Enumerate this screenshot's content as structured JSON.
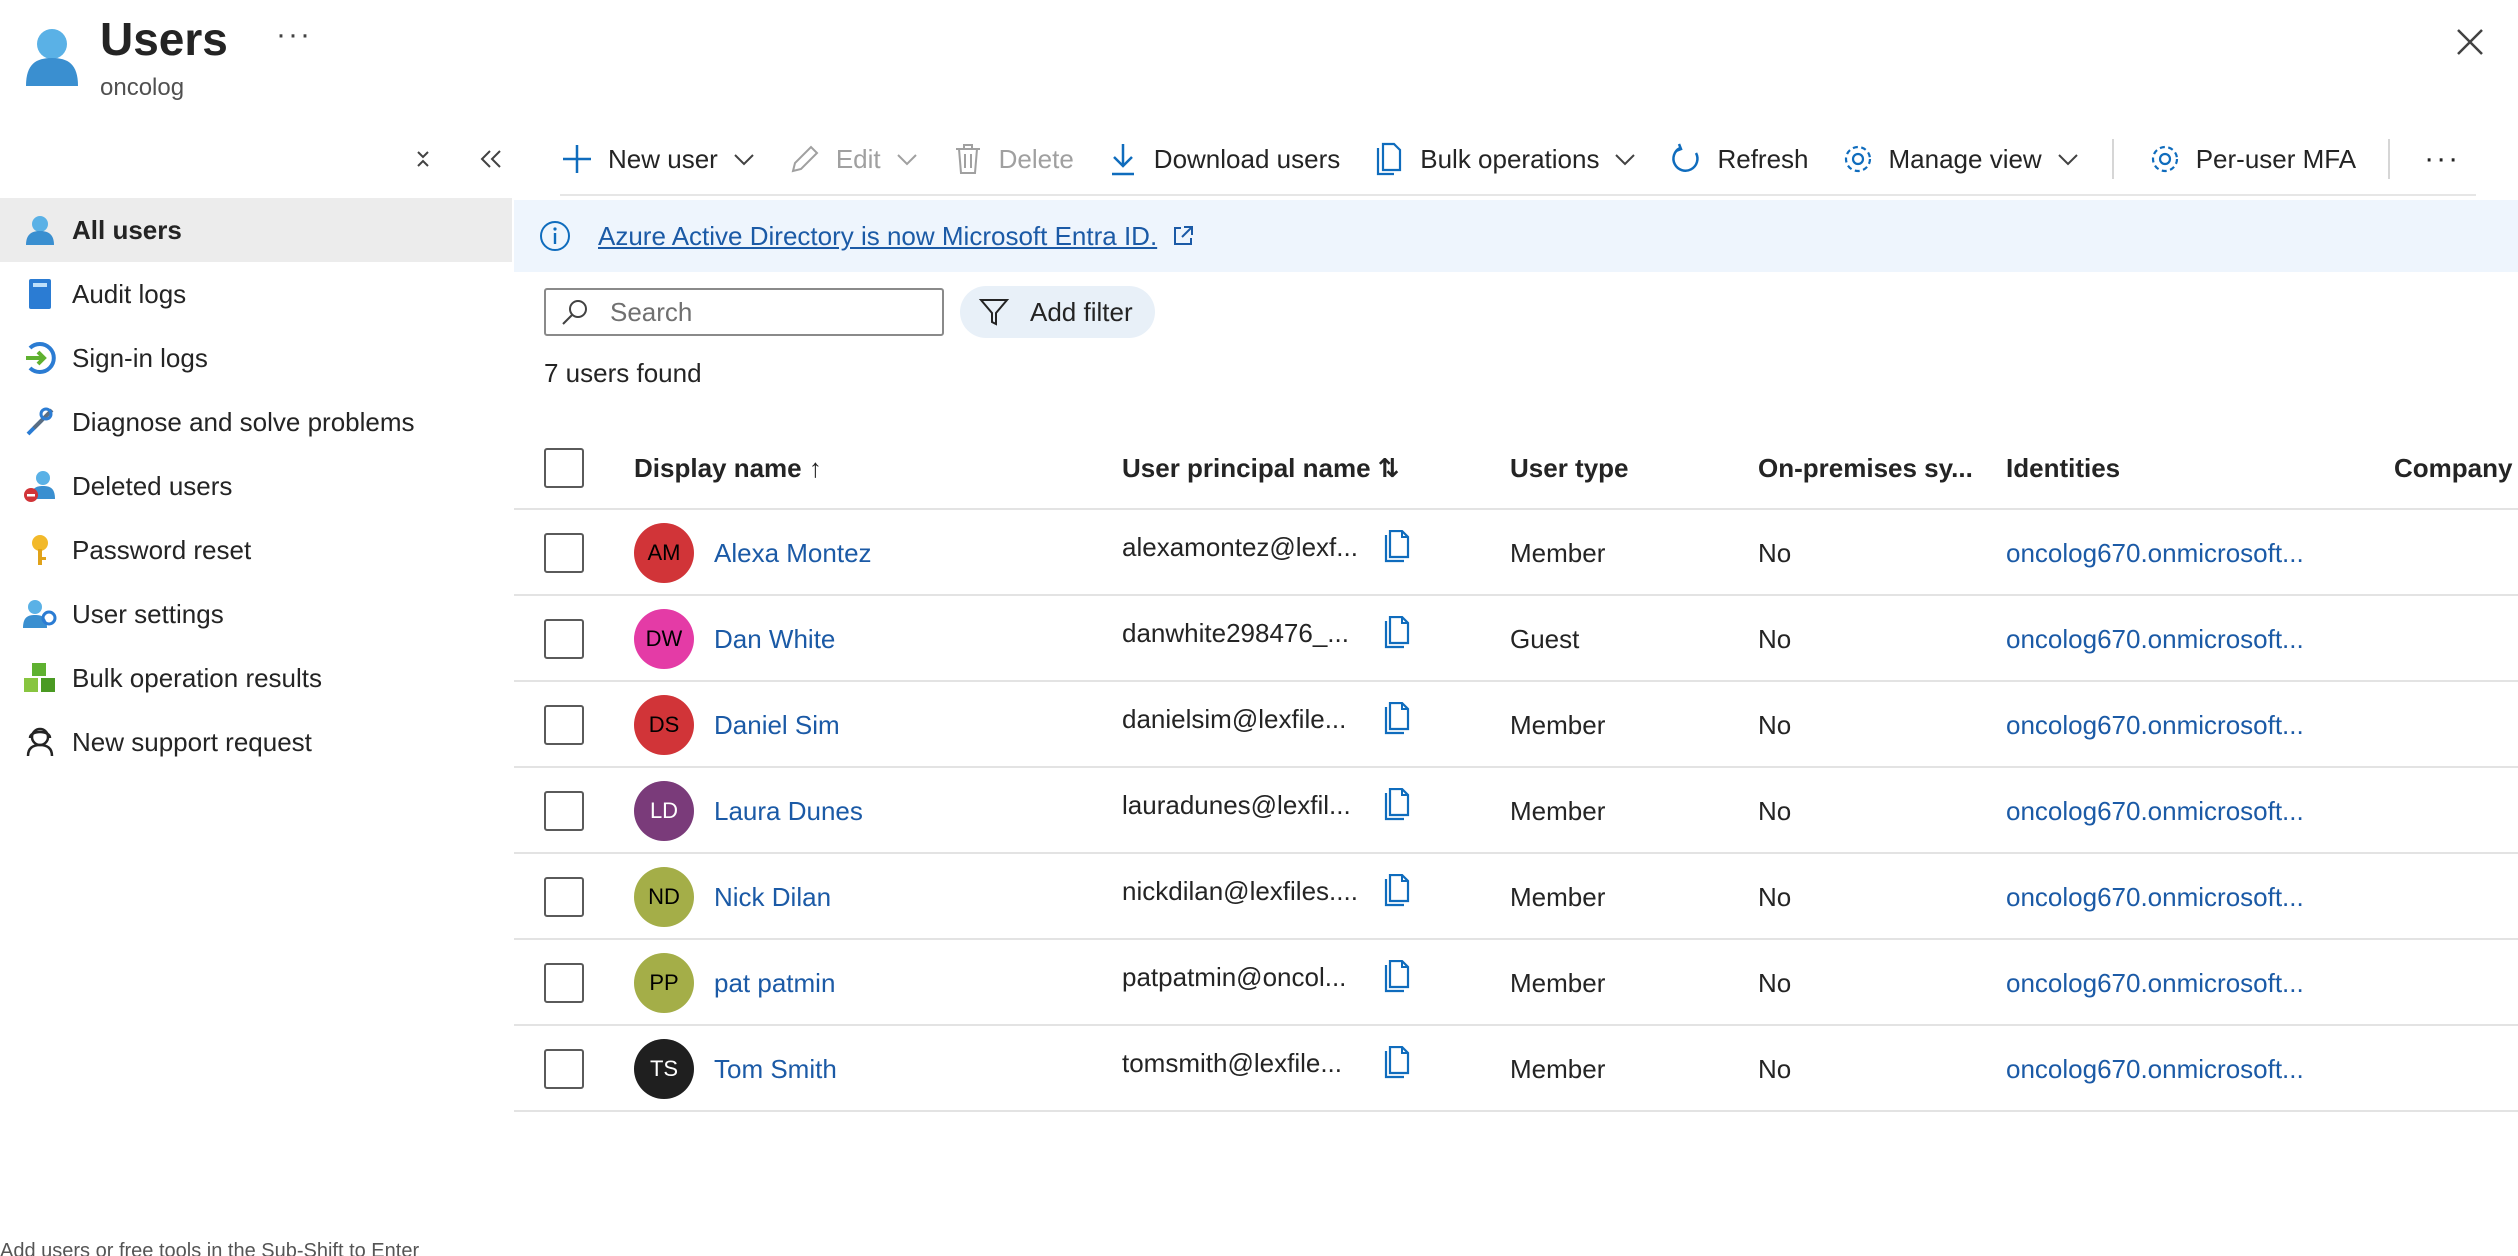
{
  "header": {
    "title": "Users",
    "subtitle": "oncolog",
    "more_label": "···"
  },
  "toolbar": {
    "new_user": "New user",
    "edit": "Edit",
    "delete": "Delete",
    "download_users": "Download users",
    "bulk_operations": "Bulk operations",
    "refresh": "Refresh",
    "manage_view": "Manage view",
    "per_user_mfa": "Per-user MFA",
    "more_label": "···"
  },
  "sidebar": {
    "items": [
      {
        "label": "All users",
        "icon": "user-icon",
        "active": true
      },
      {
        "label": "Audit logs",
        "icon": "book-icon"
      },
      {
        "label": "Sign-in logs",
        "icon": "sign-in-icon"
      },
      {
        "label": "Diagnose and solve problems",
        "icon": "wrench-icon"
      },
      {
        "label": "Deleted users",
        "icon": "deleted-user-icon"
      },
      {
        "label": "Password reset",
        "icon": "key-icon"
      },
      {
        "label": "User settings",
        "icon": "user-settings-icon"
      },
      {
        "label": "Bulk operation results",
        "icon": "cubes-icon"
      },
      {
        "label": "New support request",
        "icon": "support-icon"
      }
    ],
    "footer": "Add users or free tools in the Sub-Shift to Enter"
  },
  "banner": {
    "text": "Azure Active Directory is now Microsoft Entra ID."
  },
  "search": {
    "placeholder": "Search"
  },
  "filter": {
    "label": "Add filter"
  },
  "results": {
    "count_text": "7 users found"
  },
  "table": {
    "columns": [
      "Display name ↑",
      "User principal name ⇅",
      "User type",
      "On-premises sy...",
      "Identities",
      "Company n"
    ],
    "rows": [
      {
        "initials": "AM",
        "name": "Alexa Montez",
        "upn": "alexamontez@lexf...",
        "type": "Member",
        "onprem": "No",
        "identity": "oncolog670.onmicrosoft...",
        "avatar_bg": "#d13438",
        "avatar_fg": "#000000"
      },
      {
        "initials": "DW",
        "name": "Dan White",
        "upn": "danwhite298476_...",
        "type": "Guest",
        "onprem": "No",
        "identity": "oncolog670.onmicrosoft...",
        "avatar_bg": "#e43ba6",
        "avatar_fg": "#000000"
      },
      {
        "initials": "DS",
        "name": "Daniel Sim",
        "upn": "danielsim@lexfile...",
        "type": "Member",
        "onprem": "No",
        "identity": "oncolog670.onmicrosoft...",
        "avatar_bg": "#d13438",
        "avatar_fg": "#000000"
      },
      {
        "initials": "LD",
        "name": "Laura Dunes",
        "upn": "lauradunes@lexfil...",
        "type": "Member",
        "onprem": "No",
        "identity": "oncolog670.onmicrosoft...",
        "avatar_bg": "#7a3b7a",
        "avatar_fg": "#ffffff"
      },
      {
        "initials": "ND",
        "name": "Nick Dilan",
        "upn": "nickdilan@lexfiles....",
        "type": "Member",
        "onprem": "No",
        "identity": "oncolog670.onmicrosoft...",
        "avatar_bg": "#a4ae48",
        "avatar_fg": "#000000"
      },
      {
        "initials": "PP",
        "name": "pat patmin",
        "upn": "patpatmin@oncol...",
        "type": "Member",
        "onprem": "No",
        "identity": "oncolog670.onmicrosoft...",
        "avatar_bg": "#a4ae48",
        "avatar_fg": "#000000"
      },
      {
        "initials": "TS",
        "name": "Tom Smith",
        "upn": "tomsmith@lexfile...",
        "type": "Member",
        "onprem": "No",
        "identity": "oncolog670.onmicrosoft...",
        "avatar_bg": "#1f1f1f",
        "avatar_fg": "#ffffff"
      }
    ]
  },
  "colors": {
    "accent": "#0f6cbd",
    "link": "#1b5aa6",
    "banner_bg": "#eef5fd",
    "active_nav_bg": "#ececec"
  }
}
